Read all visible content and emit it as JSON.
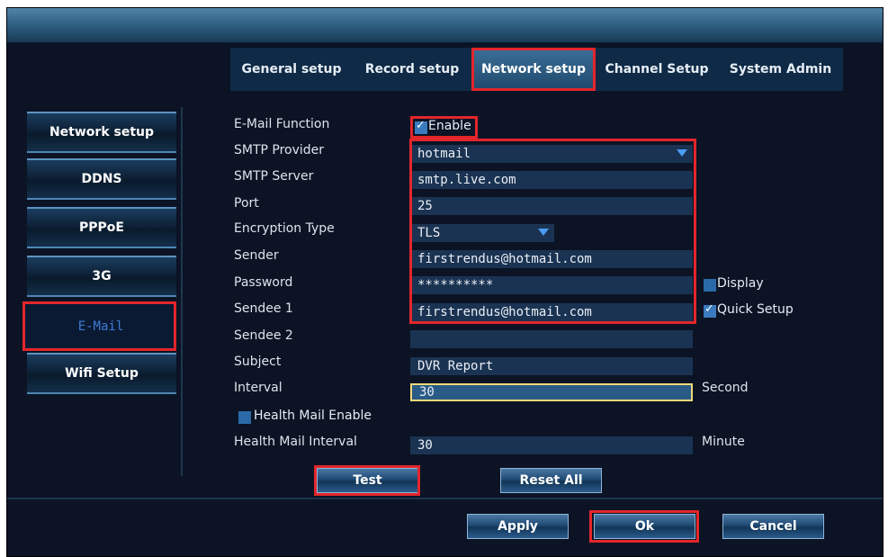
{
  "tabs": [
    {
      "label": "General setup",
      "active": false
    },
    {
      "label": "Record setup",
      "active": false
    },
    {
      "label": "Network setup",
      "active": true
    },
    {
      "label": "Channel Setup",
      "active": false
    },
    {
      "label": "System Admin",
      "active": false
    }
  ],
  "sidebar": {
    "items": [
      {
        "label": "Network setup"
      },
      {
        "label": "DDNS"
      },
      {
        "label": "PPPoE"
      },
      {
        "label": "3G"
      },
      {
        "label": "E-Mail",
        "active": true
      },
      {
        "label": "Wifi Setup"
      }
    ]
  },
  "form": {
    "email_function_label": "E-Mail Function",
    "enable_label": "Enable",
    "enable_checked": true,
    "smtp_provider_label": "SMTP Provider",
    "smtp_provider_value": "hotmail",
    "smtp_server_label": "SMTP Server",
    "smtp_server_value": "smtp.live.com",
    "port_label": "Port",
    "port_value": "25",
    "encryption_label": "Encryption Type",
    "encryption_value": "TLS",
    "sender_label": "Sender",
    "sender_value": "firstrendus@hotmail.com",
    "password_label": "Password",
    "password_value": "**********",
    "display_label": "Display",
    "display_checked": false,
    "sendee1_label": "Sendee 1",
    "sendee1_value": "firstrendus@hotmail.com",
    "quick_setup_label": "Quick Setup",
    "quick_setup_checked": true,
    "sendee2_label": "Sendee 2",
    "sendee2_value": "",
    "subject_label": "Subject",
    "subject_value": "DVR Report",
    "interval_label": "Interval",
    "interval_value": "30",
    "interval_unit": "Second",
    "health_mail_enable_label": "Health Mail Enable",
    "health_mail_enable_checked": false,
    "health_mail_interval_label": "Health Mail Interval",
    "health_mail_interval_value": "30",
    "health_mail_interval_unit": "Minute"
  },
  "buttons": {
    "test": "Test",
    "reset_all": "Reset All",
    "apply": "Apply",
    "ok": "Ok",
    "cancel": "Cancel"
  },
  "colors": {
    "background": "#0b1324",
    "highlight": "#e3262b",
    "field": "#1b3352",
    "active_sidebar_text": "#3f7bd6"
  }
}
